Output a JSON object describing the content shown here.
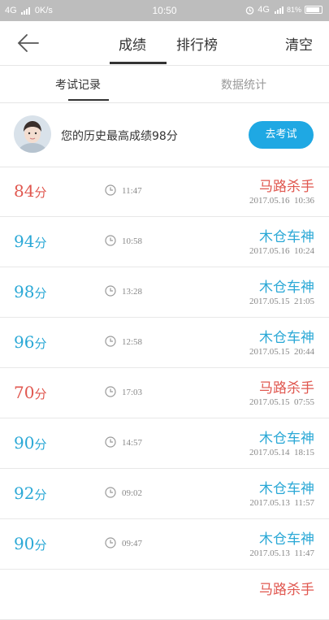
{
  "status": {
    "network_left": "4G",
    "speed": "0K/s",
    "time": "10:50",
    "network_right": "4G",
    "battery": "81%"
  },
  "nav": {
    "tab_score": "成绩",
    "tab_rank": "排行榜",
    "clear": "清空"
  },
  "subtabs": {
    "records": "考试记录",
    "stats": "数据统计"
  },
  "profile": {
    "best_text": "您的历史最高成绩98分",
    "exam_button": "去考试"
  },
  "colors": {
    "fail": "#e0574f",
    "pass": "#2aa8d6",
    "button": "#1fa8e3"
  },
  "records": [
    {
      "score": "84",
      "unit": "分",
      "duration": "11:47",
      "result": "马路杀手",
      "date": "2017.05.16",
      "time": "10:36",
      "status": "fail"
    },
    {
      "score": "94",
      "unit": "分",
      "duration": "10:58",
      "result": "木仓车神",
      "date": "2017.05.16",
      "time": "10:24",
      "status": "pass"
    },
    {
      "score": "98",
      "unit": "分",
      "duration": "13:28",
      "result": "木仓车神",
      "date": "2017.05.15",
      "time": "21:05",
      "status": "pass"
    },
    {
      "score": "96",
      "unit": "分",
      "duration": "12:58",
      "result": "木仓车神",
      "date": "2017.05.15",
      "time": "20:44",
      "status": "pass"
    },
    {
      "score": "70",
      "unit": "分",
      "duration": "17:03",
      "result": "马路杀手",
      "date": "2017.05.15",
      "time": "07:55",
      "status": "fail"
    },
    {
      "score": "90",
      "unit": "分",
      "duration": "14:57",
      "result": "木仓车神",
      "date": "2017.05.14",
      "time": "18:15",
      "status": "pass"
    },
    {
      "score": "92",
      "unit": "分",
      "duration": "09:02",
      "result": "木仓车神",
      "date": "2017.05.13",
      "time": "11:57",
      "status": "pass"
    },
    {
      "score": "90",
      "unit": "分",
      "duration": "09:47",
      "result": "木仓车神",
      "date": "2017.05.13",
      "time": "11:47",
      "status": "pass"
    },
    {
      "score": "",
      "unit": "",
      "duration": "",
      "result": "马路杀手",
      "date": "",
      "time": "",
      "status": "fail"
    }
  ]
}
